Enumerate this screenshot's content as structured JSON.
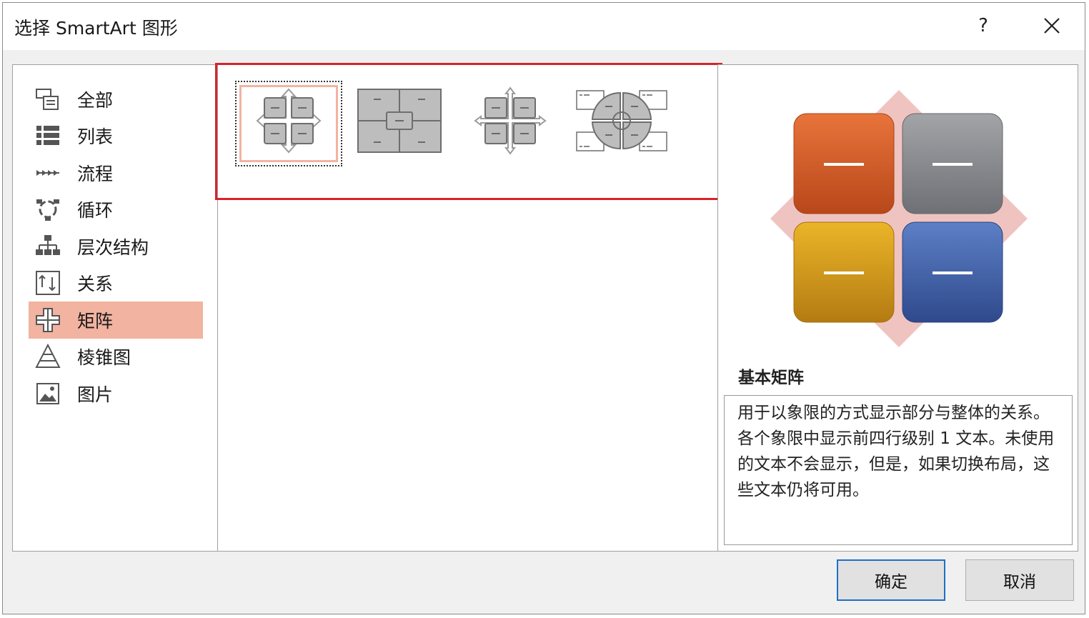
{
  "window": {
    "title": "选择 SmartArt 图形",
    "help_label": "?"
  },
  "categories": [
    {
      "label": "全部",
      "icon": "all-icon"
    },
    {
      "label": "列表",
      "icon": "list-icon"
    },
    {
      "label": "流程",
      "icon": "process-icon"
    },
    {
      "label": "循环",
      "icon": "cycle-icon"
    },
    {
      "label": "层次结构",
      "icon": "hierarchy-icon"
    },
    {
      "label": "关系",
      "icon": "relationship-icon"
    },
    {
      "label": "矩阵",
      "icon": "matrix-icon",
      "selected": true
    },
    {
      "label": "棱锥图",
      "icon": "pyramid-icon"
    },
    {
      "label": "图片",
      "icon": "picture-icon"
    }
  ],
  "layouts": [
    {
      "name": "basic-matrix",
      "selected": true
    },
    {
      "name": "titled-matrix"
    },
    {
      "name": "grid-matrix"
    },
    {
      "name": "cycle-matrix"
    }
  ],
  "preview": {
    "title": "基本矩阵",
    "description": "用于以象限的方式显示部分与整体的关系。各个象限中显示前四行级别 1 文本。未使用的文本不会显示，但是，如果切换布局，这些文本仍将可用。",
    "quadrant_colors": [
      "#d05a22",
      "#88898d",
      "#d69a1c",
      "#3f60a8"
    ],
    "diamond_color": "#efc4c0"
  },
  "buttons": {
    "ok": "确定",
    "cancel": "取消"
  },
  "colors": {
    "selection_fill": "#f2b3a1",
    "highlight_border": "#d8232a",
    "primary_border": "#1f6fc5"
  }
}
